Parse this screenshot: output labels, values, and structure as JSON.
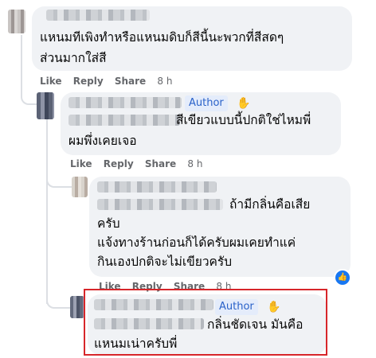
{
  "comments": [
    {
      "text_lines": [
        "แหนมทีเพิงทำหรือแหนมดิบก็สีนี้นะพวกที่สีสดๆ",
        "ส่วนมากใส่สี"
      ],
      "actions": {
        "like": "Like",
        "reply": "Reply",
        "share": "Share",
        "time": "8 h"
      }
    },
    {
      "badge": "Author",
      "badge_icon": "raised-hand-icon",
      "text_lines": [
        "สีเขียวแบบนี้ปกติใช่ไหมพี่",
        "ผมพึ่งเคยเจอ"
      ],
      "actions": {
        "like": "Like",
        "reply": "Reply",
        "share": "Share",
        "time": "8 h"
      }
    },
    {
      "text_lines": [
        "ถ้ามีกลิ่นคือเสีย",
        "ครับ",
        "แจ้งทางร้านก่อนก็ได้ครับผมเคยทำแค่",
        "กินเองปกติจะไม่เขียวครับ"
      ],
      "actions": {
        "like": "Like",
        "reply": "Reply",
        "share": "Share",
        "time": "8 h"
      },
      "reaction": "like-reaction-icon"
    },
    {
      "badge": "Author",
      "badge_icon": "raised-hand-icon",
      "text_lines": [
        "กลิ่นชัดเจน มันคือ",
        "แหนมเน่าครับพี่"
      ]
    }
  ],
  "colors": {
    "highlight": "#d7262a",
    "badge_text": "#2a62c9",
    "bubble": "#f0f2f5"
  }
}
